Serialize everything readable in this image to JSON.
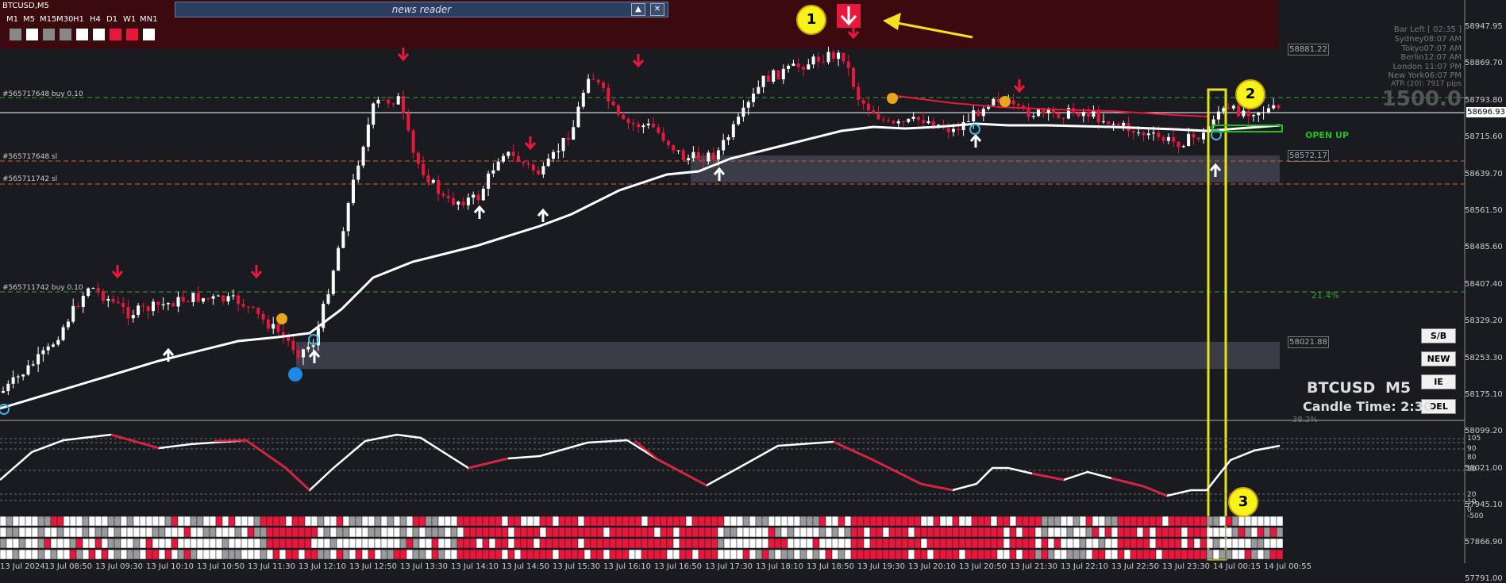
{
  "symbol_tab": "BTCUSD,M5",
  "timeframes": [
    "M1",
    "M5",
    "M15",
    "M30",
    "H1",
    "H4",
    "D1",
    "W1",
    "MN1"
  ],
  "tf_colors": [
    "#888888",
    "#ffffff",
    "#888888",
    "#888888",
    "#ffffff",
    "#ffffff",
    "#e8183c",
    "#e8183c",
    "#ffffff"
  ],
  "news_reader": {
    "title": "news reader"
  },
  "info_panel": {
    "bar_left": "Bar Left  [ 02:35 ]",
    "sydney": "Sydney08:07 AM",
    "tokyo": "Tokyo07:07 AM",
    "berlin": "Berlin12:07 AM",
    "london": "London 11:07 PM",
    "newyork": "New York06:07 PM",
    "atr": "ATR (20): 7917 pips",
    "value": "1500.0"
  },
  "orders": {
    "buy1": "#565717648 buy 0.10",
    "buy2": "#565711742 buy 0.10",
    "sl1": "#565717648 sl",
    "sl2": "#565711742 sl"
  },
  "open_up": "OPEN UP",
  "pct": "21.4%",
  "price_boxes": [
    "58881.22",
    "58572.17",
    "58021.88",
    "58696.93"
  ],
  "y_axis": [
    "58947.95",
    "58869.70",
    "58793.80",
    "58715.60",
    "58639.70",
    "58561.50",
    "58485.60",
    "58407.40",
    "58329.20",
    "58253.30",
    "58175.10",
    "58099.20",
    "58021.00",
    "57945.10",
    "57866.90",
    "57791.00"
  ],
  "osc_axis": [
    "105",
    "90",
    "80",
    "50",
    "20",
    "10",
    "0",
    "-500"
  ],
  "x_axis": [
    "13 Jul 2024",
    "13 Jul 08:50",
    "13 Jul 09:30",
    "13 Jul 10:10",
    "13 Jul 10:50",
    "13 Jul 11:30",
    "13 Jul 12:10",
    "13 Jul 12:50",
    "13 Jul 13:30",
    "13 Jul 14:10",
    "13 Jul 14:50",
    "13 Jul 15:30",
    "13 Jul 16:10",
    "13 Jul 16:50",
    "13 Jul 17:30",
    "13 Jul 18:10",
    "13 Jul 18:50",
    "13 Jul 19:30",
    "13 Jul 20:10",
    "13 Jul 20:50",
    "13 Jul 21:30",
    "13 Jul 22:10",
    "13 Jul 22:50",
    "13 Jul 23:30",
    "14 Jul 00:15",
    "14 Jul 00:55"
  ],
  "side_buttons": [
    "S/B",
    "NEW",
    "IE",
    "DEL"
  ],
  "footer": {
    "symbol": "BTCUSD",
    "tf": "M5",
    "candle_time": "Candle Time: 2:30"
  },
  "fib_label": "38.2%",
  "annotations": [
    "1",
    "2",
    "3"
  ],
  "colors": {
    "bull": "#ffffff",
    "bear": "#e8183c",
    "ma": "#ffffff",
    "accent_yellow": "#f6f21a",
    "green": "#22c01a"
  }
}
